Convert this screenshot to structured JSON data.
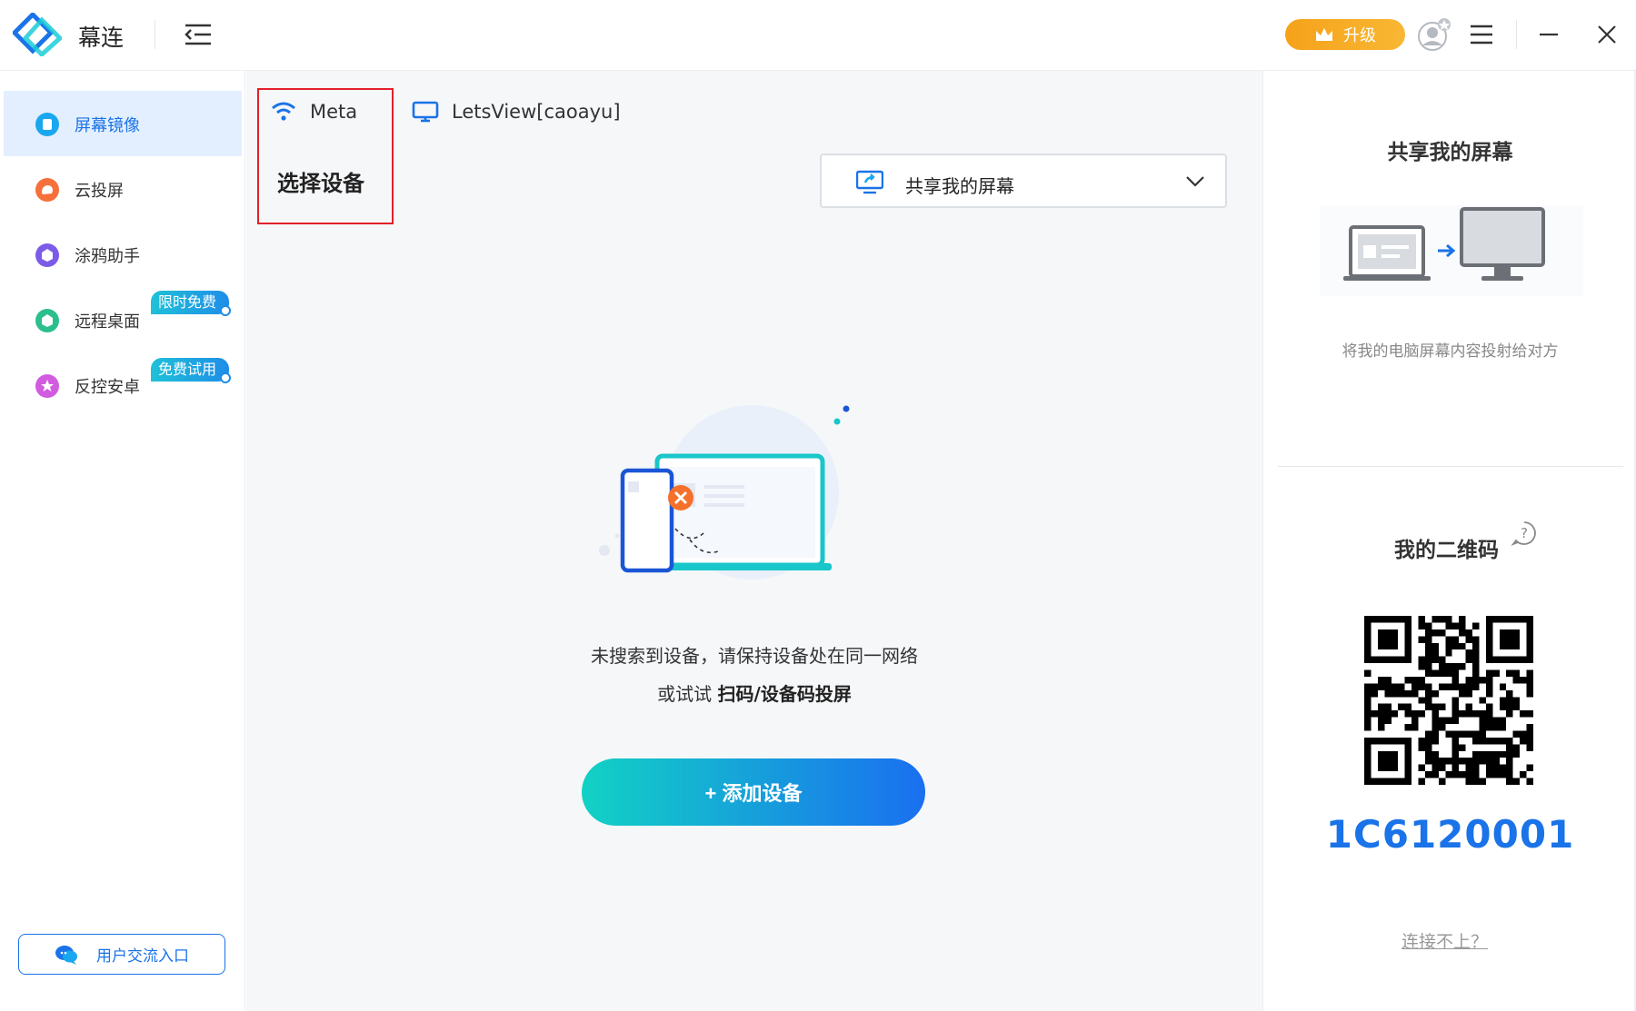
{
  "app": {
    "title": "幕连",
    "upgrade_label": "升级",
    "colors": {
      "accent": "#1a73e8",
      "upgrade": "#f6a21a",
      "highlight_border": "#e3202a"
    }
  },
  "sidebar": {
    "items": [
      {
        "label": "屏幕镜像",
        "icon": "mirror-icon",
        "active": true
      },
      {
        "label": "云投屏",
        "icon": "cloud-cast-icon",
        "active": false
      },
      {
        "label": "涂鸦助手",
        "icon": "doodle-icon",
        "active": false
      },
      {
        "label": "远程桌面",
        "icon": "remote-desktop-icon",
        "active": false,
        "badge": "限时免费"
      },
      {
        "label": "反控安卓",
        "icon": "android-control-icon",
        "active": false,
        "badge": "免费试用"
      }
    ],
    "feedback_label": "用户交流入口"
  },
  "main": {
    "device_tabs": [
      {
        "label": "Meta",
        "icon": "wifi-icon"
      },
      {
        "label": "LetsView[caoayu]",
        "icon": "monitor-icon"
      }
    ],
    "select_device_label": "选择设备",
    "share_dropdown_label": "共享我的屏幕",
    "empty_message_line1": "未搜索到设备，请保持设备处在同一网络",
    "empty_message_prefix": "或试试",
    "empty_message_link": "扫码/设备码投屏",
    "add_device_label": "+ 添加设备"
  },
  "right_panel": {
    "share_title": "共享我的屏幕",
    "share_desc": "将我的电脑屏幕内容投射给对方",
    "qr_title": "我的二维码",
    "qr_code_number": "1C6120001",
    "cant_connect_label": "连接不上？"
  }
}
